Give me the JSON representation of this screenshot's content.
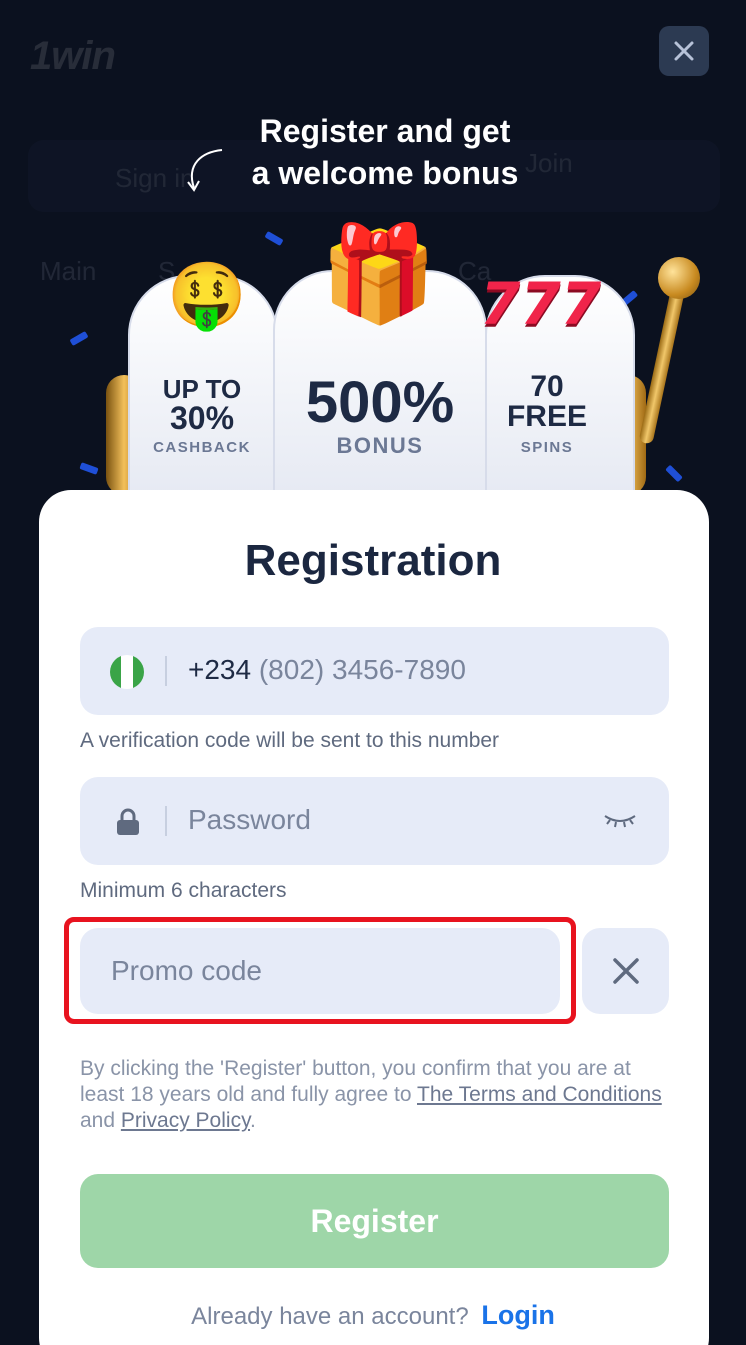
{
  "background": {
    "logo": "1win",
    "signin_label": "Sign in",
    "join_label": "Join",
    "nav_items": [
      "Main",
      "S",
      "Ca"
    ]
  },
  "promo": {
    "heading_line1": "Register and get",
    "heading_line2": "a welcome bonus",
    "left_reel": {
      "line1": "UP TO",
      "line2": "30%",
      "sub": "CASHBACK"
    },
    "center_reel": {
      "main": "500%",
      "sub": "BONUS"
    },
    "right_reel": {
      "line1": "70",
      "line2": "FREE",
      "sub": "SPINS"
    }
  },
  "form": {
    "title": "Registration",
    "phone": {
      "country_code": "+234",
      "placeholder": "(802) 3456-7890",
      "hint": "A verification code will be sent to this number"
    },
    "password": {
      "placeholder": "Password",
      "hint": "Minimum 6 characters"
    },
    "promo_code": {
      "placeholder": "Promo code"
    },
    "legal": {
      "text_before": "By clicking the 'Register' button, you confirm that you are at least 18 years old and fully agree to ",
      "terms_link": "The Terms and Conditions",
      "text_middle": " and ",
      "privacy_link": "Privacy Policy",
      "text_after": "."
    },
    "register_label": "Register",
    "login_prompt": "Already have an account?",
    "login_link": "Login"
  },
  "colors": {
    "page_bg": "#0d1424",
    "register_button": "#9ed6a8",
    "login_link": "#1a73e8",
    "highlight": "#e8131f",
    "field_bg": "#e6ebf8"
  },
  "icons": [
    "close-icon",
    "curl-arrow-icon",
    "nigeria-flag-icon",
    "lock-icon",
    "eye-closed-icon",
    "clear-icon"
  ]
}
